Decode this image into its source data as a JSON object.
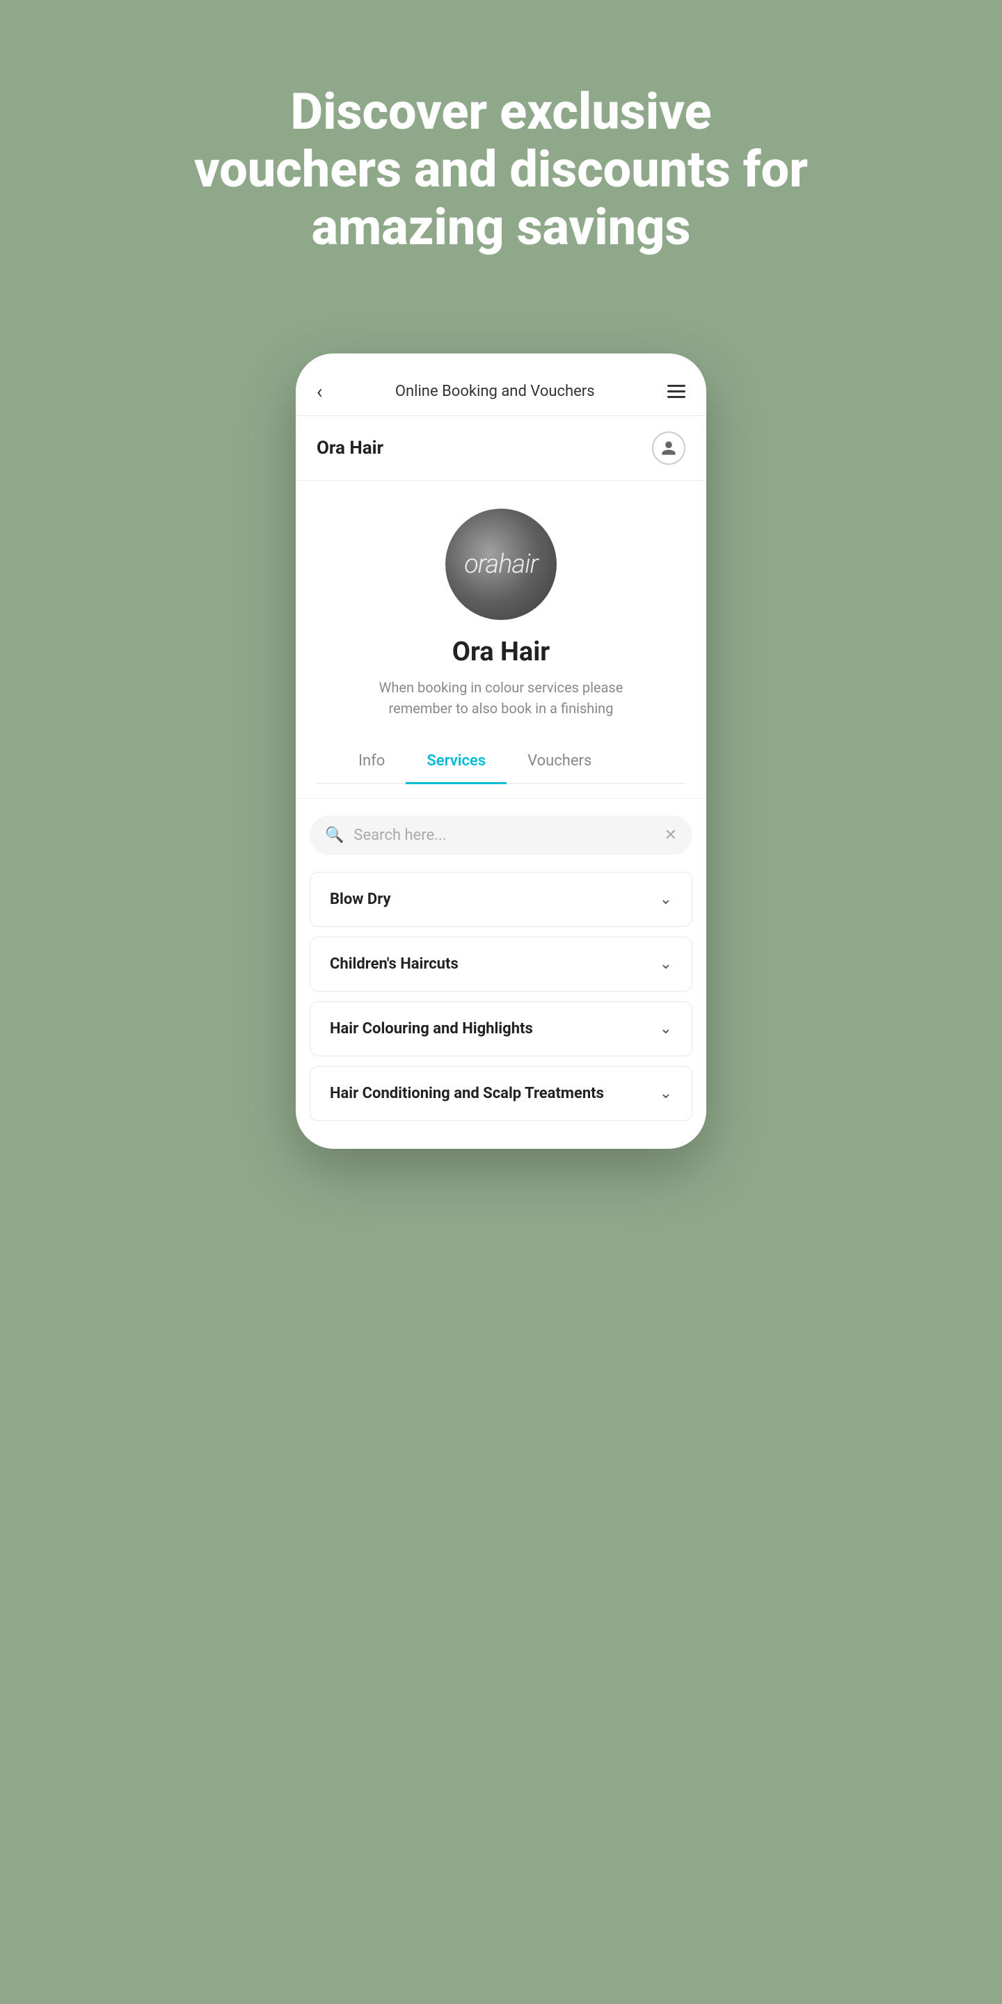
{
  "page": {
    "background_color": "#8fa88a",
    "hero_text": "Discover exclusive vouchers and discounts for amazing savings"
  },
  "nav": {
    "title": "Online Booking and Vouchers",
    "back_label": "‹",
    "menu_label": "menu"
  },
  "app_header": {
    "brand_name": "Ora Hair",
    "user_icon_label": "user"
  },
  "profile": {
    "avatar_text": "orahair",
    "name": "Ora Hair",
    "description": "When booking in colour services please remember to also book in a finishing"
  },
  "tabs": [
    {
      "id": "info",
      "label": "Info",
      "active": false
    },
    {
      "id": "services",
      "label": "Services",
      "active": true
    },
    {
      "id": "vouchers",
      "label": "Vouchers",
      "active": false
    }
  ],
  "search": {
    "placeholder": "Search here..."
  },
  "services": [
    {
      "id": "blow-dry",
      "label": "Blow Dry"
    },
    {
      "id": "childrens-haircuts",
      "label": "Children's Haircuts"
    },
    {
      "id": "hair-colouring",
      "label": "Hair Colouring and Highlights"
    },
    {
      "id": "hair-conditioning",
      "label": "Hair Conditioning and Scalp Treatments"
    }
  ]
}
